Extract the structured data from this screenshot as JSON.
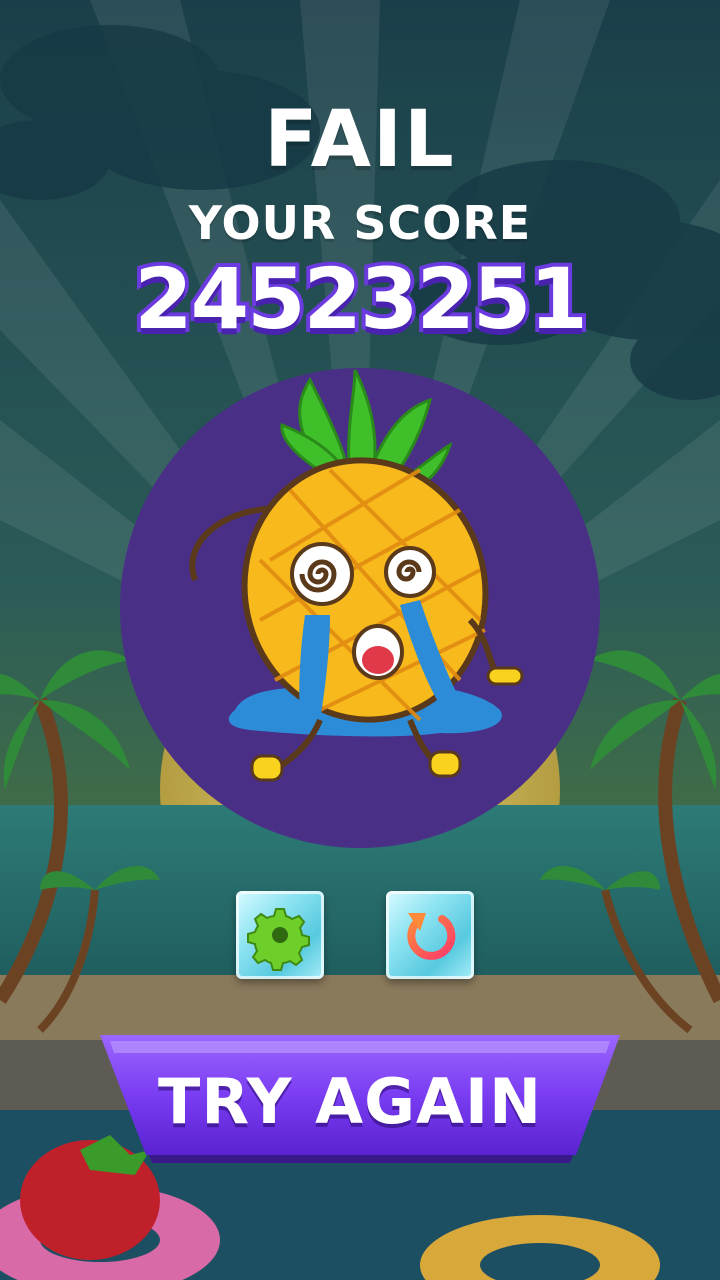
{
  "result": {
    "title": "FAIL",
    "score_label": "YOUR SCORE",
    "score_value": "24523251"
  },
  "character": {
    "name": "pineapple",
    "mood": "crying"
  },
  "buttons": {
    "settings_icon": "gear-icon",
    "restart_icon": "restart-icon",
    "try_again_label": "TRY AGAIN"
  },
  "colors": {
    "accent_purple": "#6b3be0",
    "circle": "#4a2f86",
    "gear": "#6fcf2a",
    "restart": "#ff5c5c"
  }
}
